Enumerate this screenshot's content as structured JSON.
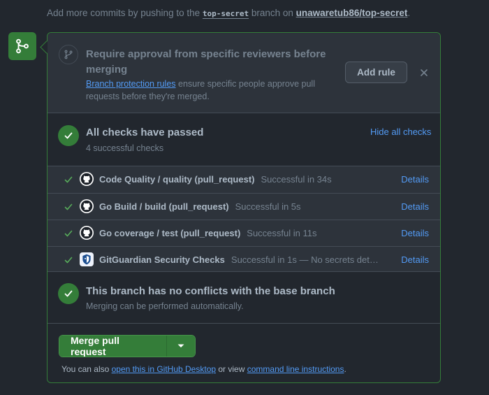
{
  "top": {
    "prefix": "Add more commits by pushing to the ",
    "branch": "top-secret",
    "middle": " branch on ",
    "repo": "unawaretub86/top-secret",
    "suffix": "."
  },
  "approval": {
    "title_line1": "Require approval from specific reviewers before",
    "title_line2": "merging",
    "link": "Branch protection rules",
    "desc_line1": " ensure specific people approve pull",
    "desc_line2": "requests before they're merged.",
    "add_rule": "Add rule"
  },
  "checks": {
    "title": "All checks have passed",
    "subtitle": "4 successful checks",
    "hide_link": "Hide all checks",
    "items": [
      {
        "name": "Code Quality / quality (pull_request)",
        "status": "Successful in 34s",
        "details": "Details",
        "avatar": "github-icon"
      },
      {
        "name": "Go Build / build (pull_request)",
        "status": "Successful in 5s",
        "details": "Details",
        "avatar": "github-icon"
      },
      {
        "name": "Go coverage / test (pull_request)",
        "status": "Successful in 11s",
        "details": "Details",
        "avatar": "github-icon"
      },
      {
        "name": "GitGuardian Security Checks",
        "status": "Successful in 1s — No secrets det…",
        "details": "Details",
        "avatar": "gitguardian-icon"
      }
    ]
  },
  "conflicts": {
    "title": "This branch has no conflicts with the base branch",
    "subtitle": "Merging can be performed automatically."
  },
  "merge": {
    "button": "Merge pull request",
    "note_prefix": "You can also ",
    "note_link1": "open this in GitHub Desktop",
    "note_middle": " or view ",
    "note_link2": "command line instructions",
    "note_suffix": "."
  },
  "colors": {
    "accent_green": "#347d39",
    "link_blue": "#539bf5",
    "background": "#22272e"
  }
}
